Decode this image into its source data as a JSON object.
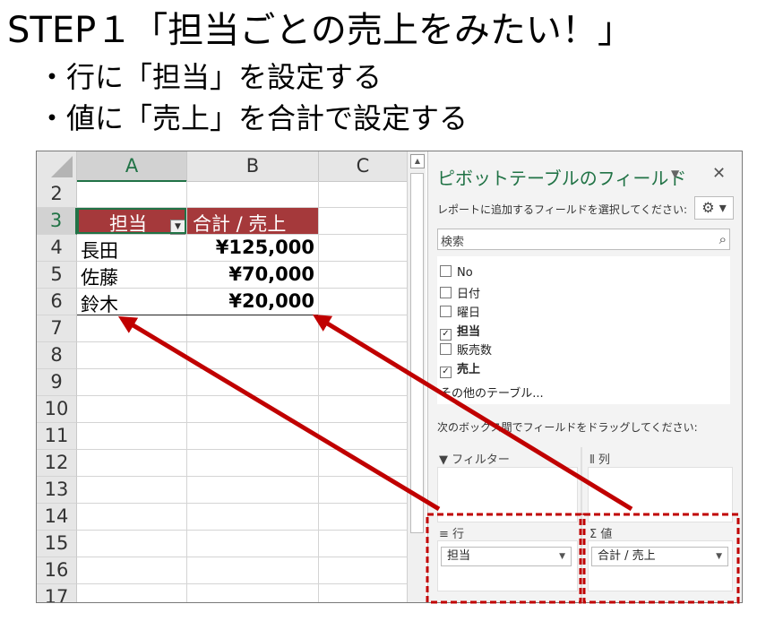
{
  "heading": {
    "title": "STEP１「担当ごとの売上をみたい！」",
    "bullets": [
      "・行に「担当」を設定する",
      "・値に「売上」を合計で設定する"
    ]
  },
  "spreadsheet": {
    "columns": [
      "A",
      "B",
      "C"
    ],
    "rows": [
      "2",
      "3",
      "4",
      "5",
      "6",
      "7",
      "8",
      "9",
      "10",
      "11",
      "12",
      "13",
      "14",
      "15",
      "16",
      "17"
    ],
    "pivot": {
      "header_row_label": "担当",
      "header_value_label": "合計 / 売上",
      "rows": [
        {
          "name": "長田",
          "value": "¥125,000"
        },
        {
          "name": "佐藤",
          "value": "¥70,000"
        },
        {
          "name": "鈴木",
          "value": "¥20,000"
        }
      ]
    }
  },
  "pivot_pane": {
    "title": "ピボットテーブルのフィールド",
    "hint": "レポートに追加するフィールドを選択してください:",
    "search_placeholder": "検索",
    "fields": [
      {
        "label": "No",
        "checked": false
      },
      {
        "label": "日付",
        "checked": false
      },
      {
        "label": "曜日",
        "checked": false
      },
      {
        "label": "担当",
        "checked": true
      },
      {
        "label": "販売数",
        "checked": false
      },
      {
        "label": "売上",
        "checked": true
      }
    ],
    "other_tables": "その他のテーブル...",
    "drag_hint": "次のボックス間でフィールドをドラッグしてください:",
    "areas": {
      "filter": "フィルター",
      "columns": "列",
      "rows": "行",
      "values": "値",
      "rows_item": "担当",
      "values_item": "合計 / 売上"
    }
  },
  "colors": {
    "pivot_header": "#a5393b",
    "accent_green": "#217346",
    "arrow_red": "#c00000"
  }
}
